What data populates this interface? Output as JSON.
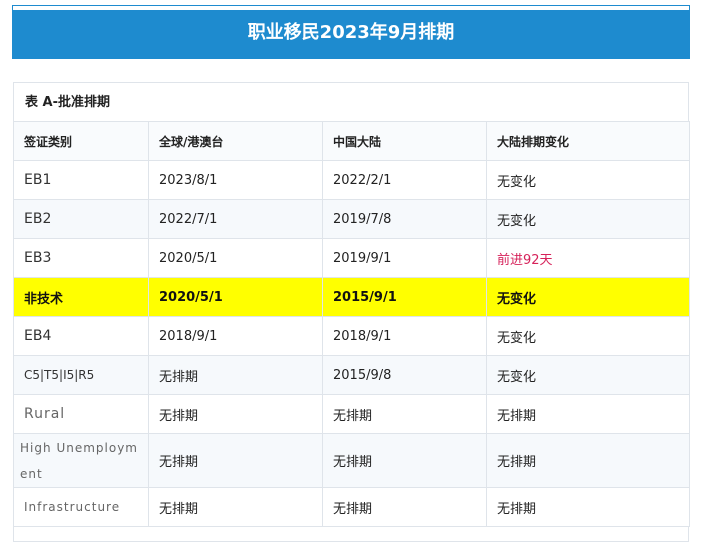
{
  "banner": {
    "title": "职业移民2023年9月排期"
  },
  "table": {
    "caption": "表 A-批准排期",
    "headers": [
      "签证类别",
      "全球/港澳台",
      "中国大陆",
      "大陆排期变化"
    ],
    "rows": [
      {
        "category": "EB1",
        "global": "2023/8/1",
        "china": "2022/2/1",
        "change": "无变化"
      },
      {
        "category": "EB2",
        "global": "2022/7/1",
        "china": "2019/7/8",
        "change": "无变化"
      },
      {
        "category": "EB3",
        "global": "2020/5/1",
        "china": "2019/9/1",
        "change": "前进92天"
      },
      {
        "category": "非技术",
        "global": "2020/5/1",
        "china": "2015/9/1",
        "change": "无变化"
      },
      {
        "category": "EB4",
        "global": "2018/9/1",
        "china": "2018/9/1",
        "change": "无变化"
      },
      {
        "category": "C5|T5|I5|R5",
        "global": "无排期",
        "china": "2015/9/8",
        "change": "无变化"
      },
      {
        "category": "Rural",
        "global": "无排期",
        "china": "无排期",
        "change": "无排期"
      },
      {
        "category": "High Unemployment",
        "global": "无排期",
        "china": "无排期",
        "change": "无排期"
      },
      {
        "category": "Infrastructure",
        "global": "无排期",
        "china": "无排期",
        "change": "无排期"
      }
    ]
  },
  "colors": {
    "banner_bg": "#1e8bcf",
    "highlight_row": "#ffff00",
    "advance_text": "#d6225a"
  }
}
